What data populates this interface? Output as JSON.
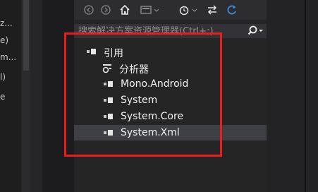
{
  "left_fragments": [
    "z...",
    "e)",
    "m...",
    "l)",
    "e"
  ],
  "toolbar": {
    "icons": [
      "back-icon",
      "forward-icon",
      "home-icon",
      "switch-views-icon",
      "history-icon",
      "sync-icon",
      "refresh-icon"
    ]
  },
  "search": {
    "placeholder": "搜索解决方案资源管理器(Ctrl+;)",
    "button_icon": "search-icon"
  },
  "tree": {
    "references_label": "引用",
    "analyzers_label": "分析器",
    "items": [
      "Mono.Android",
      "System",
      "System.Core",
      "System.Xml"
    ],
    "selected": "System.Xml"
  },
  "colors": {
    "highlight": "#e81e1e",
    "panel_bg": "#252526",
    "selected_row": "#3f3f46"
  }
}
